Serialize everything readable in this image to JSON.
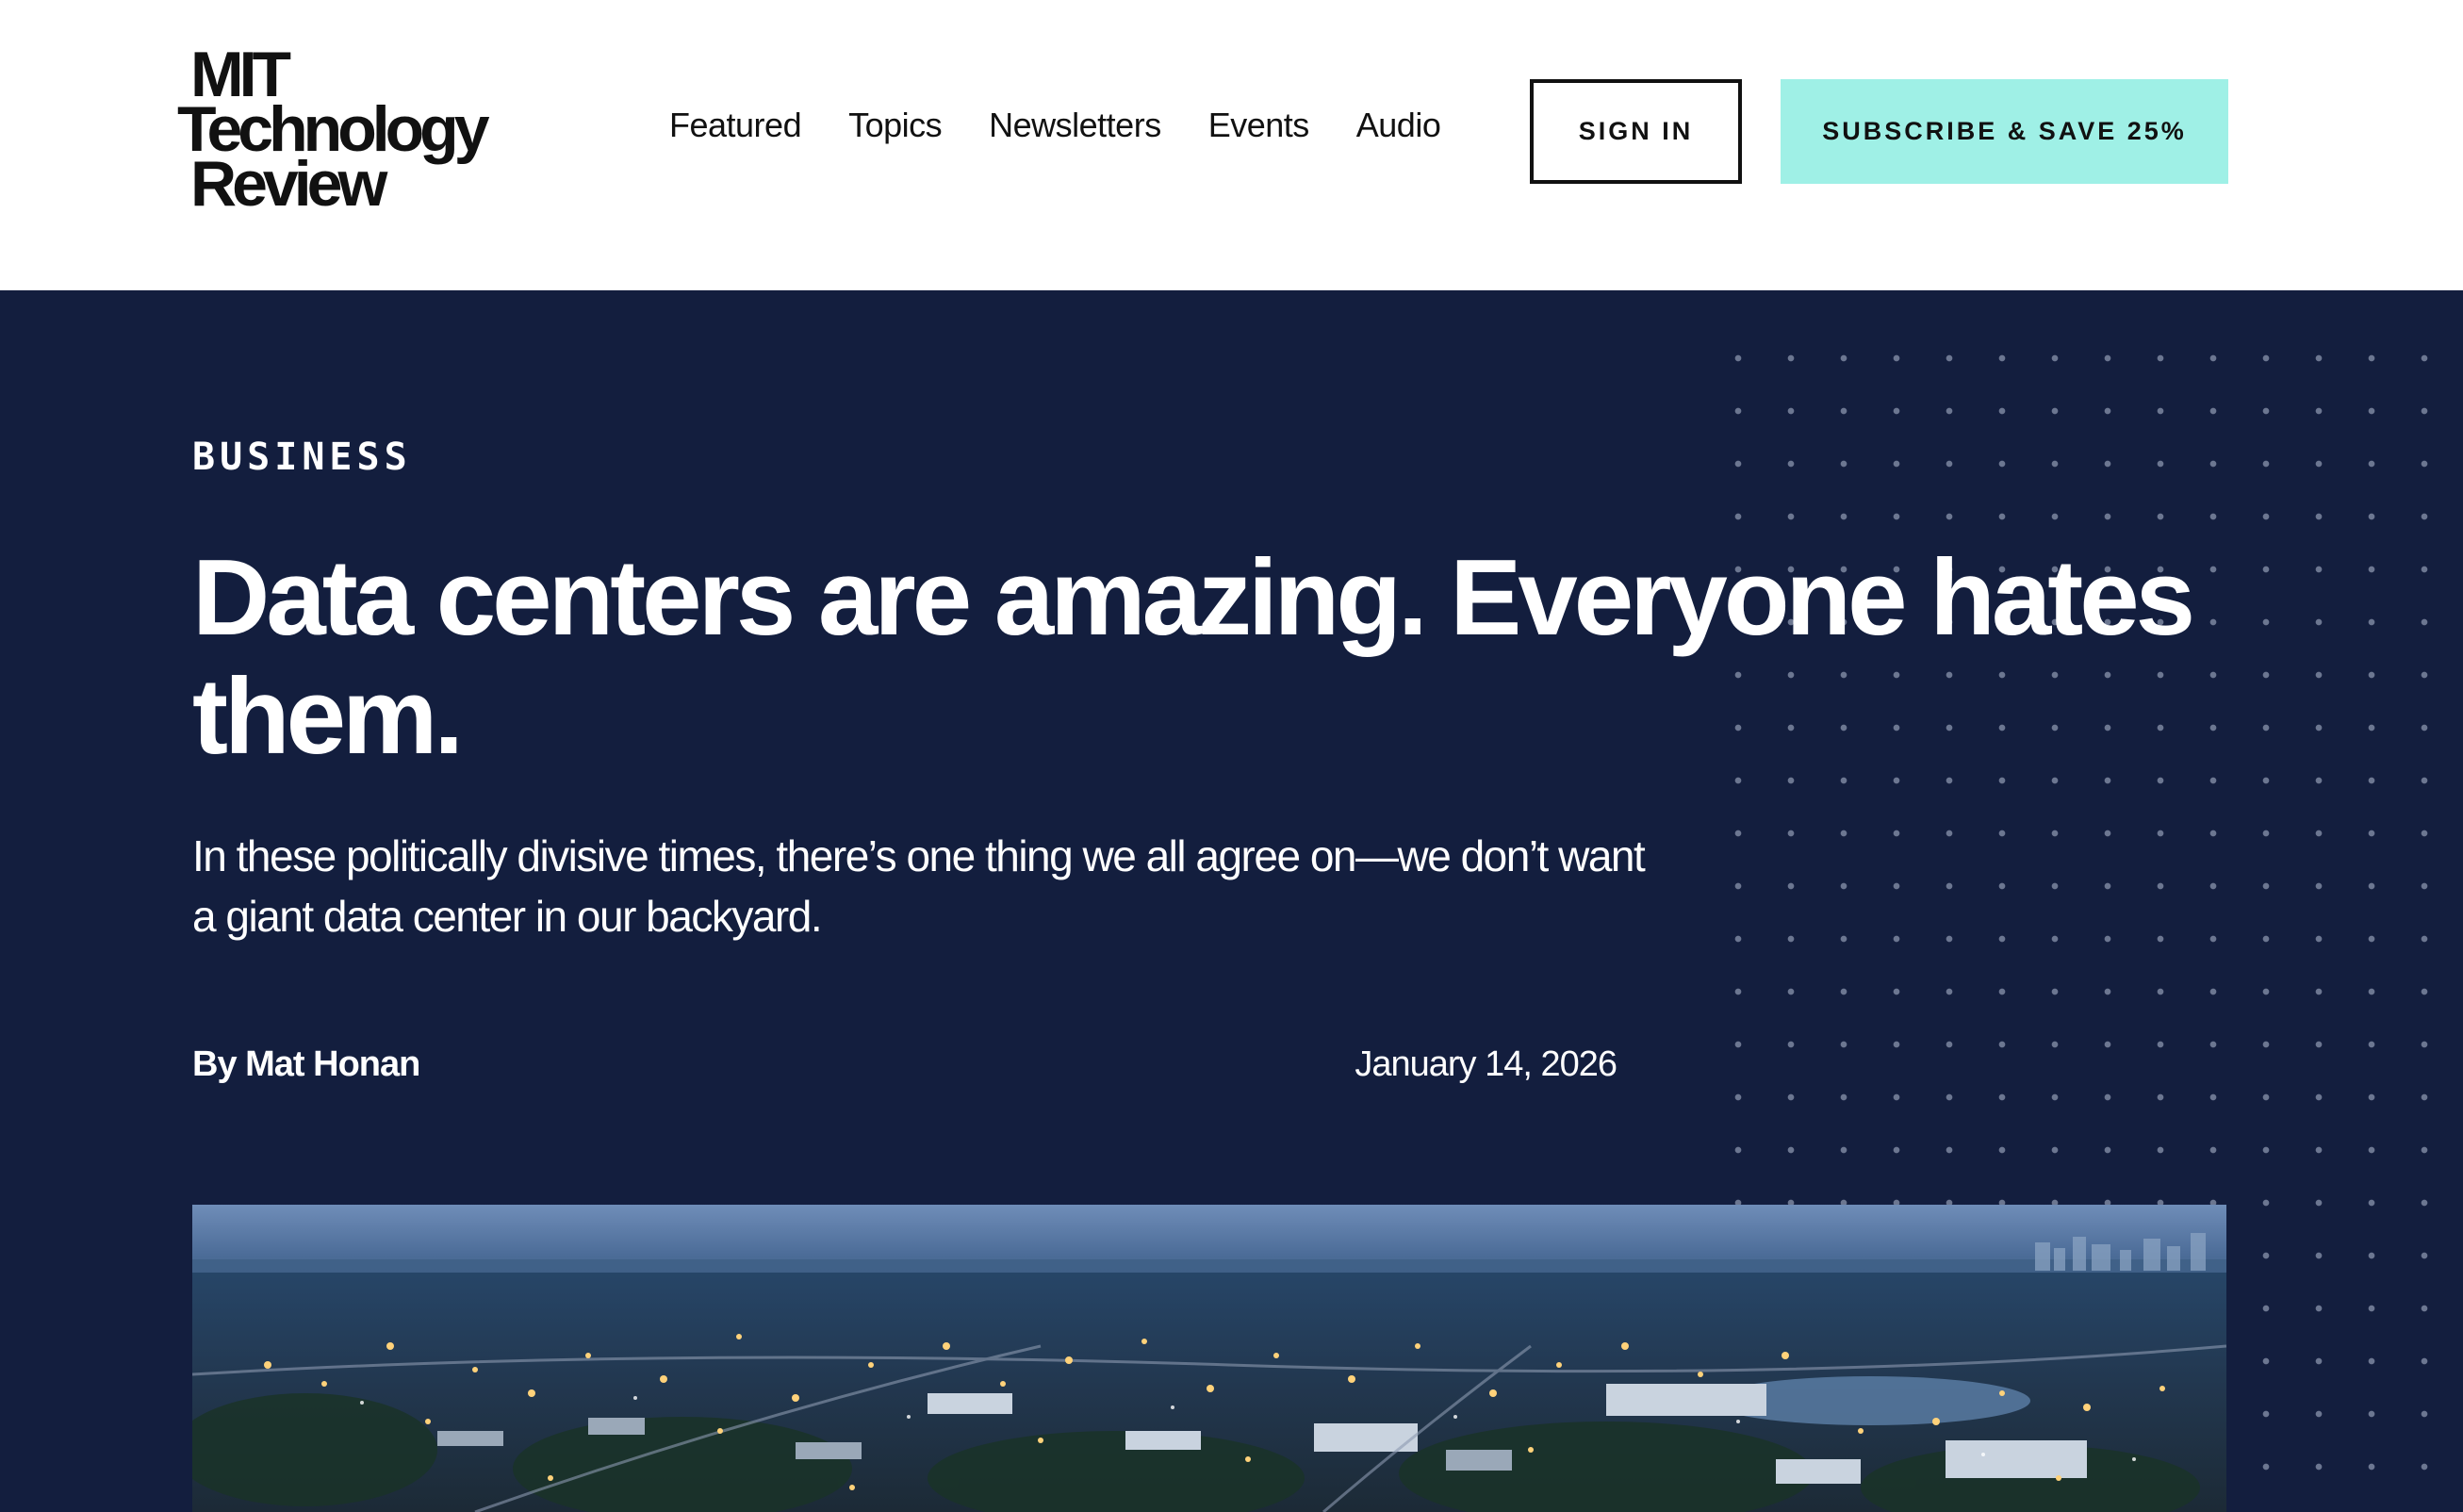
{
  "header": {
    "logo": {
      "line1": "MIT",
      "line2": "Technology",
      "line3": "Review"
    },
    "nav": [
      {
        "label": "Featured"
      },
      {
        "label": "Topics"
      },
      {
        "label": "Newsletters"
      },
      {
        "label": "Events"
      },
      {
        "label": "Audio"
      }
    ],
    "sign_in_label": "SIGN IN",
    "subscribe_label": "SUBSCRIBE & SAVE 25%"
  },
  "article": {
    "category": "BUSINESS",
    "headline": "Data centers are amazing. Everyone hates them.",
    "dek": "In these politically divisive times, there’s one thing we all agree on—we don’t want a giant data center in our backyard.",
    "byline_prefix": "By",
    "author": "Mat Honan",
    "date": "January 14, 2026"
  },
  "colors": {
    "hero_background": "#131e3e",
    "subscribe_background": "#9ff0e6",
    "text_dark": "#111111",
    "text_light": "#ffffff"
  }
}
